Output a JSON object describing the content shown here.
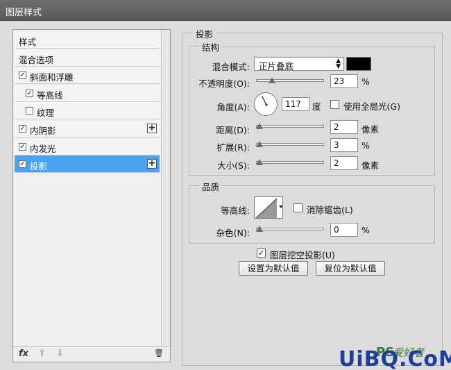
{
  "window": {
    "title": "图层样式"
  },
  "styles_list": {
    "items": [
      {
        "label": "样式",
        "checkbox": false,
        "checked": false,
        "indent": 0,
        "plus": false,
        "selected": false
      },
      {
        "label": "混合选项",
        "checkbox": false,
        "checked": false,
        "indent": 0,
        "plus": false,
        "selected": false
      },
      {
        "label": "斜面和浮雕",
        "checkbox": true,
        "checked": true,
        "indent": 0,
        "plus": false,
        "selected": false
      },
      {
        "label": "等高线",
        "checkbox": true,
        "checked": true,
        "indent": 1,
        "plus": false,
        "selected": false
      },
      {
        "label": "纹理",
        "checkbox": true,
        "checked": false,
        "indent": 1,
        "plus": false,
        "selected": false
      },
      {
        "label": "内阴影",
        "checkbox": true,
        "checked": true,
        "indent": 0,
        "plus": true,
        "selected": false
      },
      {
        "label": "内发光",
        "checkbox": true,
        "checked": true,
        "indent": 0,
        "plus": false,
        "selected": false
      },
      {
        "label": "投影",
        "checkbox": true,
        "checked": true,
        "indent": 0,
        "plus": true,
        "selected": true
      }
    ],
    "footer": {
      "fx": "fx",
      "up": "⇧",
      "down": "⇩",
      "trash": "🗑"
    },
    "check_mark": "☑",
    "plus_glyph": "+"
  },
  "drop_shadow": {
    "title": "投影",
    "structure": {
      "title": "结构",
      "blend_mode_label": "混合模式:",
      "blend_mode_value": "正片叠底",
      "color": "#000000",
      "opacity_label": "不透明度(O):",
      "opacity_value": "23",
      "opacity_unit": "%",
      "opacity_level": 0.23,
      "angle_label": "角度(A):",
      "angle_value": "117",
      "angle_unit": "度",
      "angle_degrees": 117,
      "global_light_label": "使用全局光(G)",
      "global_light_checked": false,
      "distance_label": "距离(D):",
      "distance_value": "2",
      "distance_unit": "像素",
      "spread_label": "扩展(R):",
      "spread_value": "3",
      "spread_unit": "%",
      "size_label": "大小(S):",
      "size_value": "2",
      "size_unit": "像素"
    },
    "quality": {
      "title": "品质",
      "contour_label": "等高线:",
      "anti_alias_label": "消除锯齿(L)",
      "anti_alias_checked": false,
      "noise_label": "杂色(N):",
      "noise_value": "0",
      "noise_unit": "%"
    },
    "knockout_label": "图层挖空投影(U)",
    "knockout_checked": true,
    "set_default_button": "设置为默认值",
    "reset_default_button": "复位为默认值"
  },
  "watermark": {
    "brand": "UiBQ.CoM",
    "ps": "PS",
    "text": "爱好者"
  },
  "colors": {
    "selection": "#4aa3f1",
    "panel": "#dcdcdc"
  }
}
